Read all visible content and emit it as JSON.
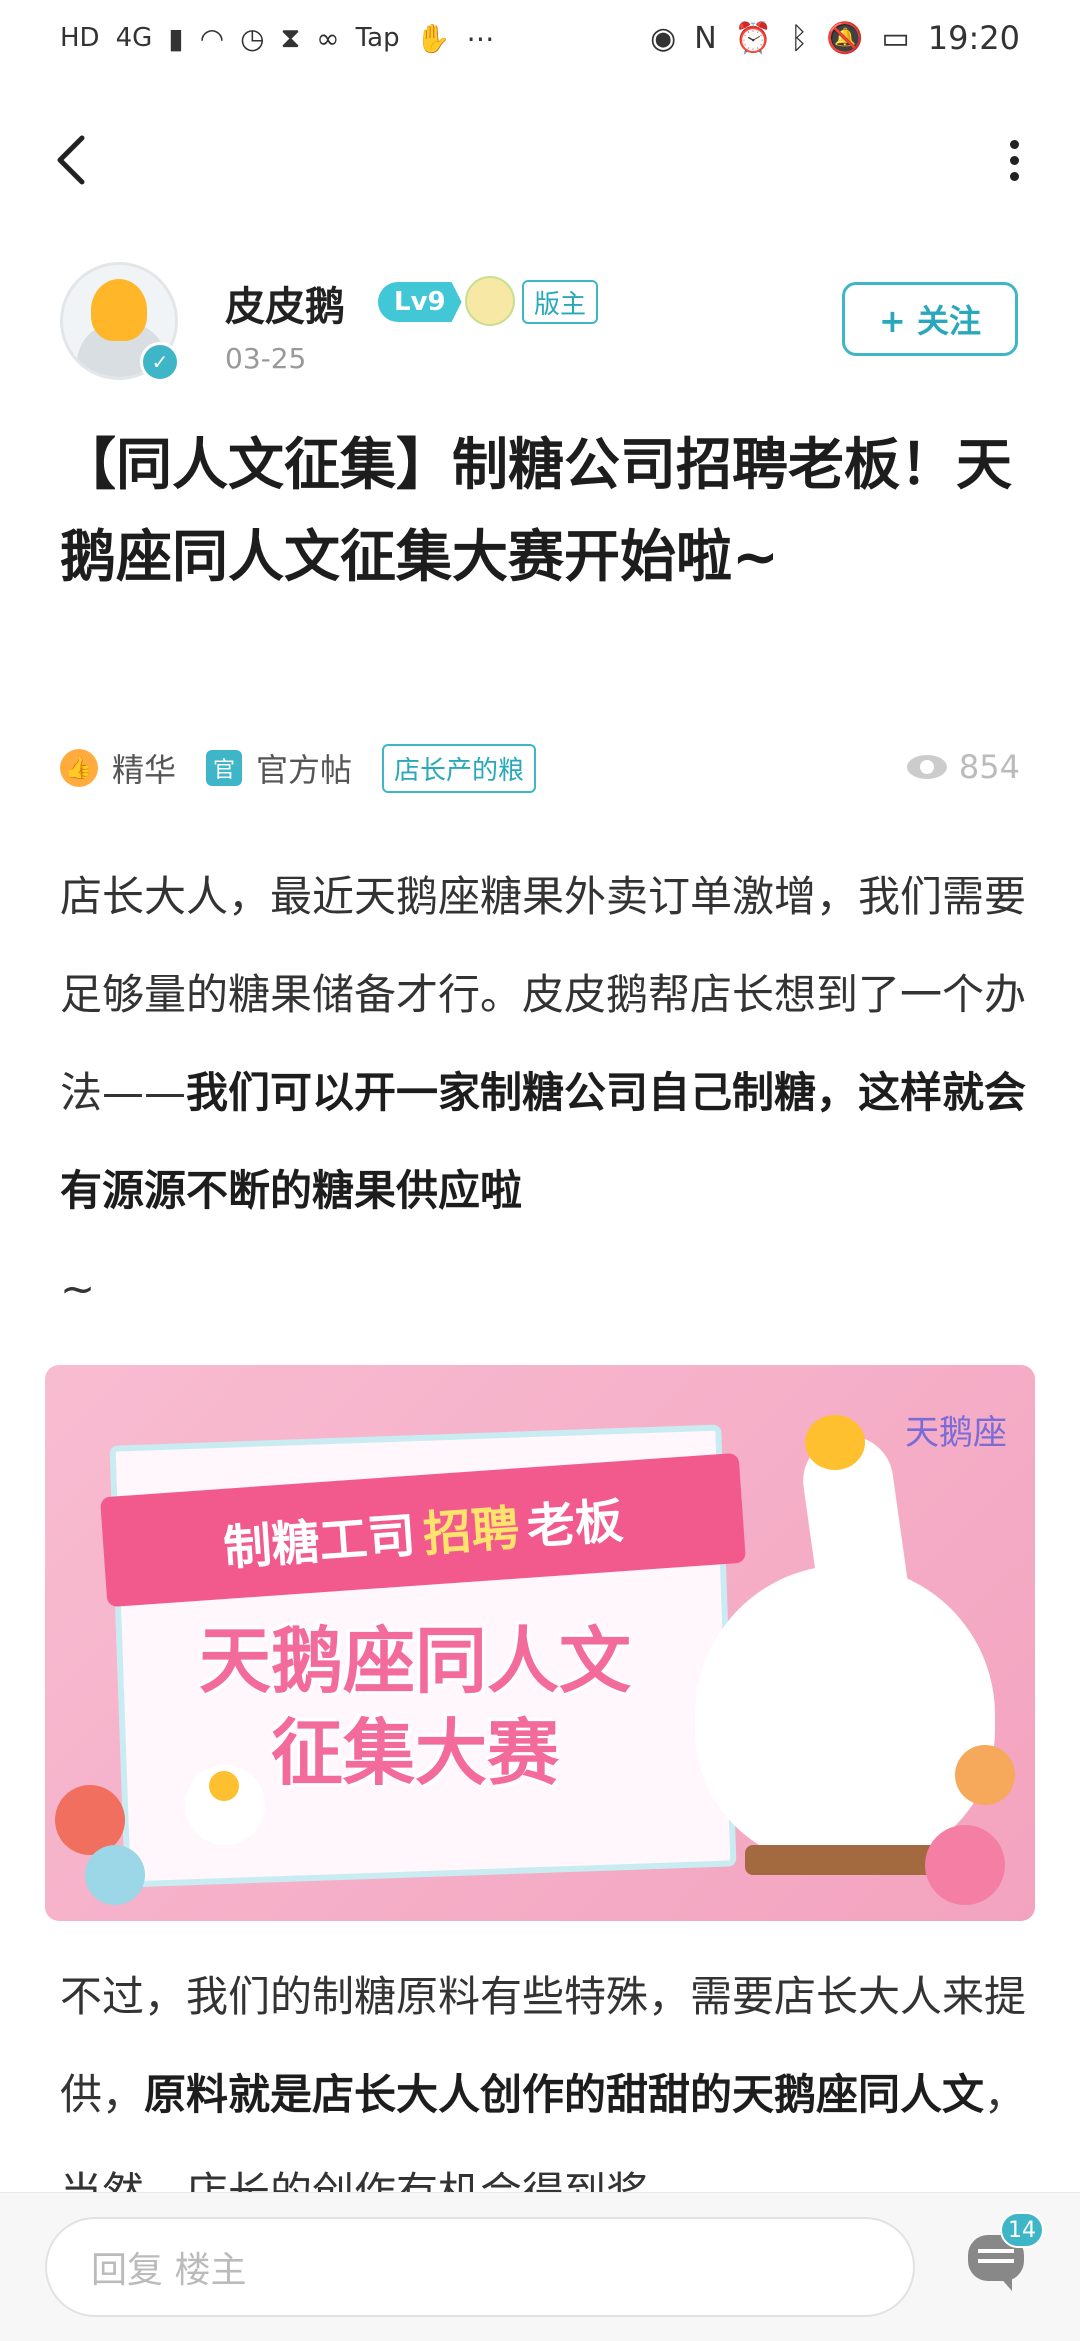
{
  "status_bar": {
    "left_icons": [
      "HD",
      "4G",
      "Tap"
    ],
    "time": "19:20"
  },
  "author": {
    "name": "皮皮鹅",
    "level": "Lv9",
    "role": "版主",
    "date": "03-25",
    "follow_label": "+ 关注"
  },
  "post": {
    "title": "【同人文征集】制糖公司招聘老板！天鹅座同人文征集大赛开始啦~",
    "tags": {
      "featured": "精华",
      "official_icon": "官",
      "official": "官方帖",
      "category": "店长产的粮"
    },
    "views": "854",
    "para1_a": "店长大人，最近天鹅座糖果外卖订单激增，我们需要足够量的糖果储备才行。皮皮鹅帮店长想到了一个办法——",
    "para1_b": "我们可以开一家制糖公司自己制糖，这样就会有源源不断的糖果供应啦",
    "para1_c": "~",
    "para2_a": "不过，我们的制糖原料有些特殊，需要店长大人来提供，",
    "para2_b": "原料就是店长大人创作的甜甜的天鹅座同人文",
    "para2_c": "，当然，店长的创作有机会得到奖"
  },
  "banner": {
    "ribbon_pre": "制糖工司",
    "ribbon_highlight": "招聘",
    "ribbon_post": "老板",
    "headline_line1": "天鹅座同人文",
    "headline_line2": "征集大赛",
    "logo": "天鹅座"
  },
  "bottom": {
    "reply_placeholder": "回复  楼主",
    "comment_count": "14"
  },
  "colors": {
    "accent": "#3fb6c8",
    "pink": "#f25a8e",
    "orange": "#ffab3d"
  }
}
